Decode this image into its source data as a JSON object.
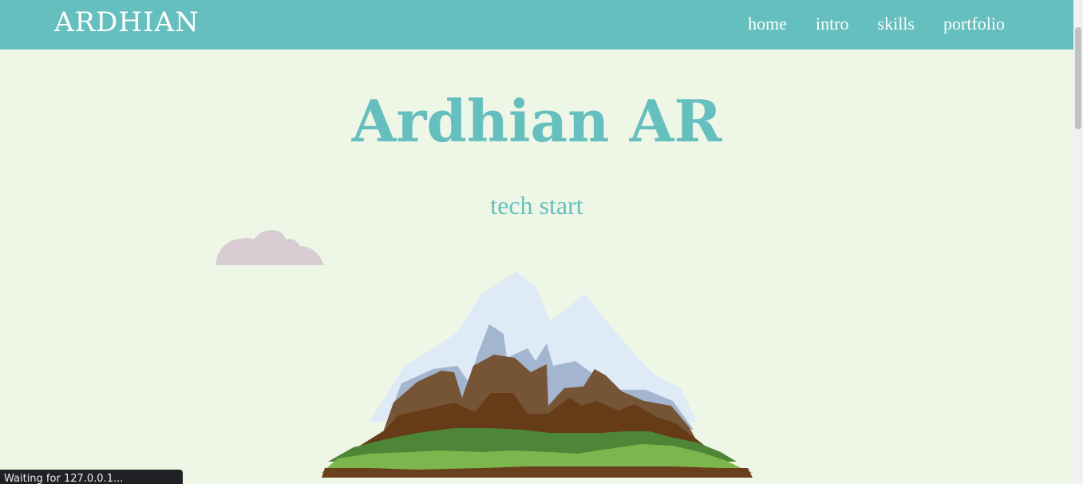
{
  "navbar": {
    "brand": "ARDHIAN",
    "links": [
      "home",
      "intro",
      "skills",
      "portfolio"
    ],
    "background_color": "#66bfbf"
  },
  "hero": {
    "title": "Ardhian AR",
    "subtitle": "tech start",
    "accent_color": "#66bfbf",
    "background_color": "#eef6e6"
  },
  "illustrations": {
    "cloud": "cloud-icon",
    "mountain": "mountain-icon"
  },
  "status_bar": {
    "text": "Waiting for 127.0.0.1..."
  }
}
